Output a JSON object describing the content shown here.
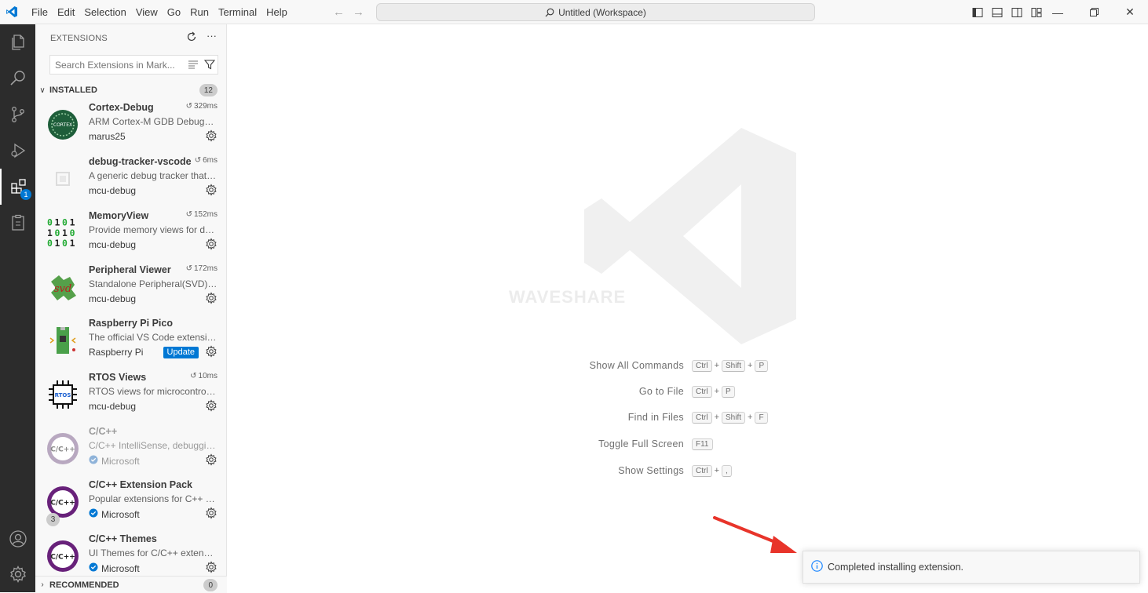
{
  "titlebar": {
    "menu": [
      "File",
      "Edit",
      "Selection",
      "View",
      "Go",
      "Run",
      "Terminal",
      "Help"
    ],
    "command_center": "Untitled (Workspace)"
  },
  "activitybar": {
    "extensions_badge": "1"
  },
  "sidebar": {
    "title": "EXTENSIONS",
    "search_placeholder": "Search Extensions in Mark...",
    "installed": {
      "label": "INSTALLED",
      "count": "12"
    },
    "recommended": {
      "label": "RECOMMENDED",
      "count": "0"
    },
    "extensions": [
      {
        "name": "Cortex-Debug",
        "time": "329ms",
        "desc": "ARM Cortex-M GDB Debugger support for VSCode",
        "publisher": "marus25",
        "verified": false,
        "update": false
      },
      {
        "name": "debug-tracker-vscode",
        "time": "6ms",
        "desc": "A generic debug tracker that can be used by other extensions",
        "publisher": "mcu-debug",
        "verified": false,
        "update": false
      },
      {
        "name": "MemoryView",
        "time": "152ms",
        "desc": "Provide memory views for debuggers",
        "publisher": "mcu-debug",
        "verified": false,
        "update": false
      },
      {
        "name": "Peripheral Viewer",
        "time": "172ms",
        "desc": "Standalone Peripheral(SVD) Viewer",
        "publisher": "mcu-debug",
        "verified": false,
        "update": false
      },
      {
        "name": "Raspberry Pi Pico",
        "time": "",
        "desc": "The official VS Code extension for Raspberry Pi Pico",
        "publisher": "Raspberry Pi",
        "verified": false,
        "update": true,
        "update_label": "Update"
      },
      {
        "name": "RTOS Views",
        "time": "10ms",
        "desc": "RTOS views for microcontrollers",
        "publisher": "mcu-debug",
        "verified": false,
        "update": false
      },
      {
        "name": "C/C++",
        "time": "",
        "desc": "C/C++ IntelliSense, debugging, and code browsing.",
        "publisher": "Microsoft",
        "verified": true,
        "update": false,
        "disabled": true
      },
      {
        "name": "C/C++ Extension Pack",
        "time": "",
        "desc": "Popular extensions for C++ development in Visual Studio Code.",
        "publisher": "Microsoft",
        "verified": true,
        "update": false,
        "count": "3"
      },
      {
        "name": "C/C++ Themes",
        "time": "",
        "desc": "UI Themes for C/C++ extension.",
        "publisher": "Microsoft",
        "verified": true,
        "update": false
      }
    ]
  },
  "editor": {
    "watermark_text": "WAVESHARE",
    "shortcuts": [
      {
        "label": "Show All Commands",
        "keys": [
          "Ctrl",
          "Shift",
          "P"
        ]
      },
      {
        "label": "Go to File",
        "keys": [
          "Ctrl",
          "P"
        ]
      },
      {
        "label": "Find in Files",
        "keys": [
          "Ctrl",
          "Shift",
          "F"
        ]
      },
      {
        "label": "Toggle Full Screen",
        "keys": [
          "F11"
        ]
      },
      {
        "label": "Show Settings",
        "keys": [
          "Ctrl",
          ","
        ]
      }
    ]
  },
  "notification": {
    "message": "Completed installing extension."
  },
  "colors": {
    "accent": "#0078d4",
    "activitybar": "#2c2c2c",
    "arrow": "#e8342a"
  }
}
